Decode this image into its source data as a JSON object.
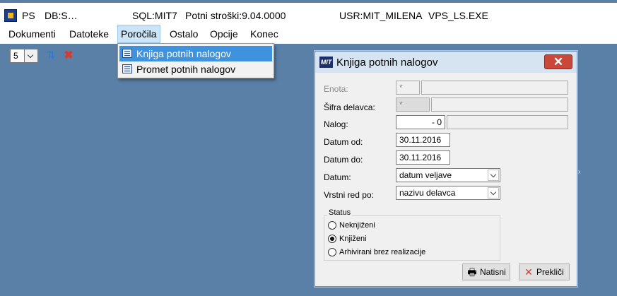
{
  "titlebar": {
    "app": "PS",
    "db": "DB:S…",
    "sql": "SQL:MIT7",
    "version": "Potni stroški:9.04.0000",
    "user": "USR:MIT_MILENA",
    "exe": "VPS_LS.EXE"
  },
  "menubar": [
    "Dokumenti",
    "Datoteke",
    "Poročila",
    "Ostalo",
    "Opcije",
    "Konec"
  ],
  "toolbar": {
    "combo_value": "5",
    "refresh_icon": "refresh-icon",
    "delete_icon": "delete-x-icon"
  },
  "dropdown": {
    "items": [
      {
        "label": "Knjiga potnih nalogov",
        "highlighted": true
      },
      {
        "label": "Promet potnih nalogov",
        "highlighted": false
      }
    ]
  },
  "dialog": {
    "title": "Knjiga potnih nalogov",
    "logo_text": "MIT",
    "fields": {
      "enota": {
        "label": "Enota:",
        "value": "*"
      },
      "sifra": {
        "label": "Šifra delavca:",
        "value": "*"
      },
      "nalog": {
        "label": "Nalog:",
        "value": "-   0"
      },
      "datum_od": {
        "label": "Datum od:",
        "value": "30.11.2016"
      },
      "datum_do": {
        "label": "Datum do:",
        "value": "30.11.2016"
      },
      "datum": {
        "label": "Datum:",
        "value": "datum veljave"
      },
      "vrstni_red": {
        "label": "Vrstni red po:",
        "value": "nazivu delavca"
      }
    },
    "status": {
      "legend": "Status",
      "options": [
        {
          "label": "Neknjiženi",
          "checked": false
        },
        {
          "label": "Knjiženi",
          "checked": true
        },
        {
          "label": "Arhivirani brez realizacije",
          "checked": false
        }
      ]
    },
    "buttons": {
      "print": "Natisni",
      "cancel": "Prekliči"
    }
  },
  "colors": {
    "desktop": "#5b80a7",
    "menu_highlight": "#3f93de",
    "close": "#c9483a"
  }
}
